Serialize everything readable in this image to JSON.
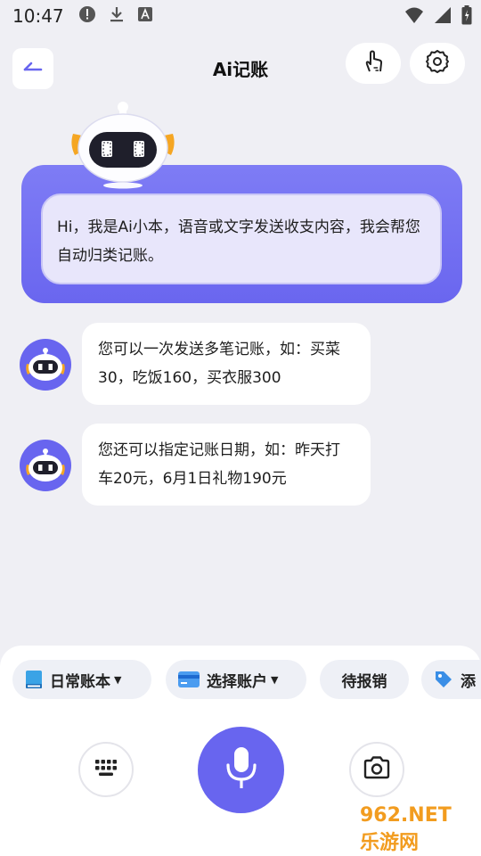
{
  "status_bar": {
    "time": "10:47"
  },
  "header": {
    "title": "Ai记账"
  },
  "intro": {
    "text": "Hi，我是Ai小本，语音或文字发送收支内容，我会帮您自动归类记账。"
  },
  "messages": [
    {
      "text": "您可以一次发送多笔记账，如：买菜30，吃饭160，买衣服300"
    },
    {
      "text": "您还可以指定记账日期，如：昨天打车20元，6月1日礼物190元"
    }
  ],
  "chips": {
    "book": "日常账本",
    "account": "选择账户",
    "pending": "待报销",
    "tag": "添"
  },
  "colors": {
    "accent": "#6865ef",
    "background": "#efeff4"
  },
  "watermark": "962.NET 乐游网"
}
